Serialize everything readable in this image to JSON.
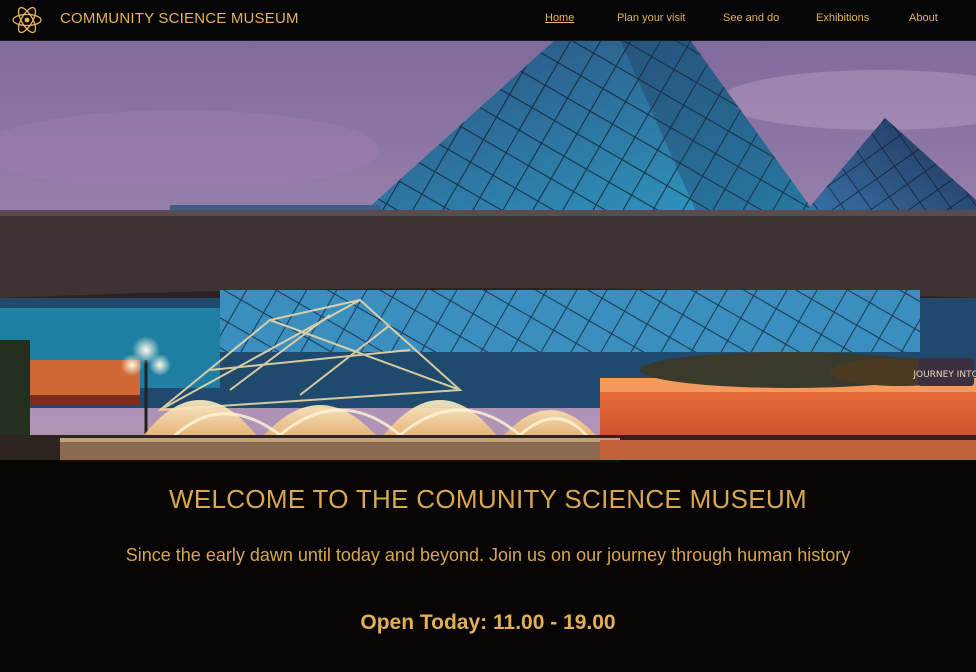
{
  "header": {
    "logo_icon": "atom-icon",
    "title": "COMMUNITY SCIENCE MUSEUM"
  },
  "nav": {
    "items": [
      {
        "label": "Home",
        "active": true
      },
      {
        "label": "Plan your visit",
        "active": false
      },
      {
        "label": "See and do",
        "active": false
      },
      {
        "label": "Exhibitions",
        "active": false
      },
      {
        "label": "About",
        "active": false
      }
    ]
  },
  "hero": {
    "heading": "WELCOME TO THE COMUNITY SCIENCE MUSEUM",
    "tagline": "Since the early dawn until today and beyond. Join us on our journey through human history",
    "hours": "Open Today: 11.00 - 19.00",
    "sign_text": "JOURNEY INTO"
  },
  "colors": {
    "accent": "#e8b25a",
    "sky": "#8e72a6",
    "glass": "#3a86b0"
  }
}
